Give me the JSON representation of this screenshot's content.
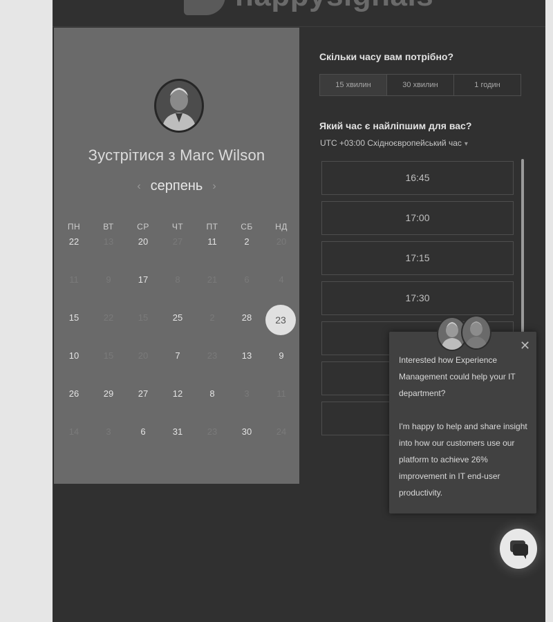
{
  "brand": {
    "name": "happysignals"
  },
  "meeting": {
    "title": "Зустрітися з Marc Wilson"
  },
  "calendar": {
    "month": "серпень",
    "weekdays": [
      "ПН",
      "ВТ",
      "СР",
      "ЧТ",
      "ПТ",
      "СБ",
      "НД"
    ],
    "rows": [
      [
        {
          "d": "22",
          "s": "b"
        },
        {
          "d": "13",
          "s": "d"
        },
        {
          "d": "20",
          "s": "b"
        },
        {
          "d": "27",
          "s": "d"
        },
        {
          "d": "11",
          "s": "b"
        },
        {
          "d": "2",
          "s": "b"
        },
        {
          "d": "20",
          "s": "d"
        }
      ],
      [
        {
          "d": "11",
          "s": "d"
        },
        {
          "d": "9",
          "s": "d"
        },
        {
          "d": "17",
          "s": "b"
        },
        {
          "d": "8",
          "s": "d"
        },
        {
          "d": "21",
          "s": "d"
        },
        {
          "d": "6",
          "s": "d"
        },
        {
          "d": "4",
          "s": "d"
        }
      ],
      [
        {
          "d": "15",
          "s": "b"
        },
        {
          "d": "22",
          "s": "d"
        },
        {
          "d": "15",
          "s": "d"
        },
        {
          "d": "25",
          "s": "b"
        },
        {
          "d": "2",
          "s": "d"
        },
        {
          "d": "28",
          "s": "b"
        },
        {
          "d": "23",
          "s": "sel"
        }
      ],
      [
        {
          "d": "10",
          "s": "b"
        },
        {
          "d": "15",
          "s": "d"
        },
        {
          "d": "20",
          "s": "d"
        },
        {
          "d": "7",
          "s": "b"
        },
        {
          "d": "23",
          "s": "d"
        },
        {
          "d": "13",
          "s": "b"
        },
        {
          "d": "9",
          "s": "b"
        }
      ],
      [
        {
          "d": "26",
          "s": "b"
        },
        {
          "d": "29",
          "s": "b"
        },
        {
          "d": "27",
          "s": "b"
        },
        {
          "d": "12",
          "s": "b"
        },
        {
          "d": "8",
          "s": "b"
        },
        {
          "d": "3",
          "s": "d"
        },
        {
          "d": "11",
          "s": "d"
        }
      ],
      [
        {
          "d": "14",
          "s": "d"
        },
        {
          "d": "3",
          "s": "d"
        },
        {
          "d": "6",
          "s": "b"
        },
        {
          "d": "31",
          "s": "b"
        },
        {
          "d": "23",
          "s": "d"
        },
        {
          "d": "30",
          "s": "b"
        },
        {
          "d": "24",
          "s": "d"
        }
      ]
    ]
  },
  "duration": {
    "question": "Скільки часу вам потрібно?",
    "options": [
      "15 хвилин",
      "30 хвилин",
      "1 годин"
    ],
    "active_index": 0
  },
  "timepick": {
    "question": "Який час є найліпшим для вас?",
    "timezone": "UTC +03:00 Східноєвропейський час",
    "slots": [
      "16:45",
      "17:00",
      "17:15",
      "17:30",
      "",
      "",
      ""
    ]
  },
  "chat": {
    "paragraph1": "Interested how Experience Management could help your IT department?",
    "paragraph2": "I'm happy to help and share insight into how our customers use our platform to achieve 26% improvement in IT end-user productivity.",
    "close_icon": "close-icon",
    "launcher_icon": "chat-bubble-icon"
  },
  "colors": {
    "page_bg": "#303030",
    "calendar_panel": "#6a6a6a",
    "selected_day": "#e0e0e0"
  }
}
